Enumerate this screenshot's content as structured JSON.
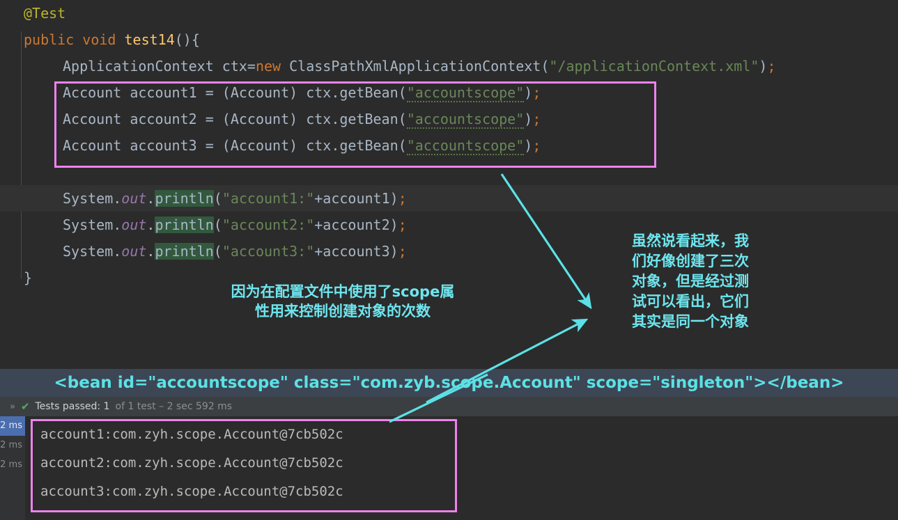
{
  "editor": {
    "lines": [
      {
        "indent": 34,
        "segments": [
          {
            "t": "@Test",
            "c": "ann"
          }
        ]
      },
      {
        "indent": 34,
        "segments": [
          {
            "t": "public",
            "c": "kw"
          },
          {
            "t": " ",
            "c": "plain"
          },
          {
            "t": "void",
            "c": "kw"
          },
          {
            "t": " ",
            "c": "plain"
          },
          {
            "t": "test14",
            "c": "mname"
          },
          {
            "t": "(){",
            "c": "plain"
          }
        ]
      },
      {
        "indent": 90,
        "segments": [
          {
            "t": "ApplicationContext ctx=",
            "c": "plain"
          },
          {
            "t": "new",
            "c": "kw"
          },
          {
            "t": " ClassPathXmlApplicationContext(",
            "c": "plain"
          },
          {
            "t": "\"/applicationContext.xml\"",
            "c": "str"
          },
          {
            "t": ")",
            "c": "plain"
          },
          {
            "t": ";",
            "c": "semi"
          }
        ]
      },
      {
        "indent": 90,
        "segments": [
          {
            "t": "Account account1 = (Account) ctx.getBean(",
            "c": "plain"
          },
          {
            "t": "\"accountscope\"",
            "c": "str squig"
          },
          {
            "t": ")",
            "c": "plain"
          },
          {
            "t": ";",
            "c": "semi"
          }
        ]
      },
      {
        "indent": 90,
        "segments": [
          {
            "t": "Account account2 = (Account) ctx.getBean(",
            "c": "plain"
          },
          {
            "t": "\"accountscope\"",
            "c": "str squig"
          },
          {
            "t": ")",
            "c": "plain"
          },
          {
            "t": ";",
            "c": "semi"
          }
        ]
      },
      {
        "indent": 90,
        "segments": [
          {
            "t": "Account account3 = (Account) ctx.getBean(",
            "c": "plain"
          },
          {
            "t": "\"accountscope\"",
            "c": "str squig"
          },
          {
            "t": ")",
            "c": "plain"
          },
          {
            "t": ";",
            "c": "semi"
          }
        ]
      },
      {
        "indent": 90,
        "segments": []
      },
      {
        "indent": 90,
        "segments": [
          {
            "t": "System.",
            "c": "plain"
          },
          {
            "t": "out",
            "c": "stat"
          },
          {
            "t": ".",
            "c": "plain"
          },
          {
            "t": "println",
            "c": "plain hl-search"
          },
          {
            "t": "(",
            "c": "plain"
          },
          {
            "t": "\"account1:\"",
            "c": "str"
          },
          {
            "t": "+account1)",
            "c": "plain"
          },
          {
            "t": ";",
            "c": "semi"
          }
        ]
      },
      {
        "indent": 90,
        "segments": [
          {
            "t": "System.",
            "c": "plain"
          },
          {
            "t": "out",
            "c": "stat"
          },
          {
            "t": ".",
            "c": "plain"
          },
          {
            "t": "println",
            "c": "plain hl-search"
          },
          {
            "t": "(",
            "c": "plain"
          },
          {
            "t": "\"account2:\"",
            "c": "str"
          },
          {
            "t": "+account2)",
            "c": "plain"
          },
          {
            "t": ";",
            "c": "semi"
          }
        ]
      },
      {
        "indent": 90,
        "segments": [
          {
            "t": "System.",
            "c": "plain"
          },
          {
            "t": "out",
            "c": "stat"
          },
          {
            "t": ".",
            "c": "plain"
          },
          {
            "t": "println",
            "c": "plain hl-search"
          },
          {
            "t": "(",
            "c": "plain"
          },
          {
            "t": "\"account3:\"",
            "c": "str"
          },
          {
            "t": "+account3)",
            "c": "plain"
          },
          {
            "t": ";",
            "c": "semi"
          }
        ]
      },
      {
        "indent": 34,
        "segments": [
          {
            "t": "}",
            "c": "plain"
          }
        ]
      }
    ]
  },
  "bean_banner": {
    "text": "<bean id=\"accountscope\" class=\"com.zyb.scope.Account\" scope=\"singleton\"></bean>"
  },
  "status_bar": {
    "expand_icon": "chevron-right-right",
    "check_icon": "check-mark",
    "label_strong": "Tests passed: 1",
    "label_dim": "of 1 test – 2 sec 592 ms"
  },
  "console": {
    "gutter": [
      {
        "label": "2 ms",
        "selected": true
      },
      {
        "label": "2 ms",
        "selected": false
      },
      {
        "label": "2 ms",
        "selected": false
      }
    ],
    "lines": [
      "account1:com.zyh.scope.Account@7cb502c",
      "account2:com.zyh.scope.Account@7cb502c",
      "account3:com.zyh.scope.Account@7cb502c"
    ]
  },
  "annotations": {
    "left_note": "因为在配置文件中使用了scope属\n性用来控制创建对象的次数",
    "right_note": "虽然说看起来，我\n们好像创建了三次\n对象，但是经过测\n试可以看出，它们\n其实是同一个对象"
  },
  "colors": {
    "background": "#2b2b2b",
    "annotation_cyan": "#6ee6ef",
    "highlight_box_magenta": "#ee82ee",
    "bean_banner_bg": "#3d4654",
    "status_bar_bg": "#3c3f41",
    "gutter_selected": "#4b6eaf",
    "string_green": "#6a8759",
    "keyword_orange": "#cc7832",
    "annotation_yellow": "#bbb529",
    "method_yellow": "#ffc66d",
    "text_gray": "#a9b7c6",
    "check_green": "#59a869",
    "search_highlight": "#32593d"
  }
}
